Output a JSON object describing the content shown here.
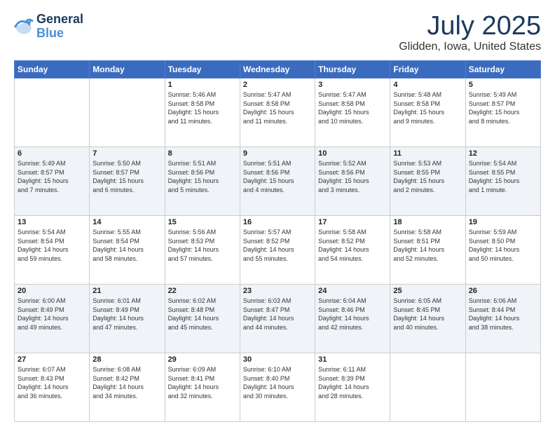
{
  "logo": {
    "line1": "General",
    "line2": "Blue"
  },
  "header": {
    "title": "July 2025",
    "subtitle": "Glidden, Iowa, United States"
  },
  "weekdays": [
    "Sunday",
    "Monday",
    "Tuesday",
    "Wednesday",
    "Thursday",
    "Friday",
    "Saturday"
  ],
  "weeks": [
    [
      {
        "day": "",
        "info": ""
      },
      {
        "day": "",
        "info": ""
      },
      {
        "day": "1",
        "info": "Sunrise: 5:46 AM\nSunset: 8:58 PM\nDaylight: 15 hours\nand 11 minutes."
      },
      {
        "day": "2",
        "info": "Sunrise: 5:47 AM\nSunset: 8:58 PM\nDaylight: 15 hours\nand 11 minutes."
      },
      {
        "day": "3",
        "info": "Sunrise: 5:47 AM\nSunset: 8:58 PM\nDaylight: 15 hours\nand 10 minutes."
      },
      {
        "day": "4",
        "info": "Sunrise: 5:48 AM\nSunset: 8:58 PM\nDaylight: 15 hours\nand 9 minutes."
      },
      {
        "day": "5",
        "info": "Sunrise: 5:49 AM\nSunset: 8:57 PM\nDaylight: 15 hours\nand 8 minutes."
      }
    ],
    [
      {
        "day": "6",
        "info": "Sunrise: 5:49 AM\nSunset: 8:57 PM\nDaylight: 15 hours\nand 7 minutes."
      },
      {
        "day": "7",
        "info": "Sunrise: 5:50 AM\nSunset: 8:57 PM\nDaylight: 15 hours\nand 6 minutes."
      },
      {
        "day": "8",
        "info": "Sunrise: 5:51 AM\nSunset: 8:56 PM\nDaylight: 15 hours\nand 5 minutes."
      },
      {
        "day": "9",
        "info": "Sunrise: 5:51 AM\nSunset: 8:56 PM\nDaylight: 15 hours\nand 4 minutes."
      },
      {
        "day": "10",
        "info": "Sunrise: 5:52 AM\nSunset: 8:56 PM\nDaylight: 15 hours\nand 3 minutes."
      },
      {
        "day": "11",
        "info": "Sunrise: 5:53 AM\nSunset: 8:55 PM\nDaylight: 15 hours\nand 2 minutes."
      },
      {
        "day": "12",
        "info": "Sunrise: 5:54 AM\nSunset: 8:55 PM\nDaylight: 15 hours\nand 1 minute."
      }
    ],
    [
      {
        "day": "13",
        "info": "Sunrise: 5:54 AM\nSunset: 8:54 PM\nDaylight: 14 hours\nand 59 minutes."
      },
      {
        "day": "14",
        "info": "Sunrise: 5:55 AM\nSunset: 8:54 PM\nDaylight: 14 hours\nand 58 minutes."
      },
      {
        "day": "15",
        "info": "Sunrise: 5:56 AM\nSunset: 8:53 PM\nDaylight: 14 hours\nand 57 minutes."
      },
      {
        "day": "16",
        "info": "Sunrise: 5:57 AM\nSunset: 8:52 PM\nDaylight: 14 hours\nand 55 minutes."
      },
      {
        "day": "17",
        "info": "Sunrise: 5:58 AM\nSunset: 8:52 PM\nDaylight: 14 hours\nand 54 minutes."
      },
      {
        "day": "18",
        "info": "Sunrise: 5:58 AM\nSunset: 8:51 PM\nDaylight: 14 hours\nand 52 minutes."
      },
      {
        "day": "19",
        "info": "Sunrise: 5:59 AM\nSunset: 8:50 PM\nDaylight: 14 hours\nand 50 minutes."
      }
    ],
    [
      {
        "day": "20",
        "info": "Sunrise: 6:00 AM\nSunset: 8:49 PM\nDaylight: 14 hours\nand 49 minutes."
      },
      {
        "day": "21",
        "info": "Sunrise: 6:01 AM\nSunset: 8:49 PM\nDaylight: 14 hours\nand 47 minutes."
      },
      {
        "day": "22",
        "info": "Sunrise: 6:02 AM\nSunset: 8:48 PM\nDaylight: 14 hours\nand 45 minutes."
      },
      {
        "day": "23",
        "info": "Sunrise: 6:03 AM\nSunset: 8:47 PM\nDaylight: 14 hours\nand 44 minutes."
      },
      {
        "day": "24",
        "info": "Sunrise: 6:04 AM\nSunset: 8:46 PM\nDaylight: 14 hours\nand 42 minutes."
      },
      {
        "day": "25",
        "info": "Sunrise: 6:05 AM\nSunset: 8:45 PM\nDaylight: 14 hours\nand 40 minutes."
      },
      {
        "day": "26",
        "info": "Sunrise: 6:06 AM\nSunset: 8:44 PM\nDaylight: 14 hours\nand 38 minutes."
      }
    ],
    [
      {
        "day": "27",
        "info": "Sunrise: 6:07 AM\nSunset: 8:43 PM\nDaylight: 14 hours\nand 36 minutes."
      },
      {
        "day": "28",
        "info": "Sunrise: 6:08 AM\nSunset: 8:42 PM\nDaylight: 14 hours\nand 34 minutes."
      },
      {
        "day": "29",
        "info": "Sunrise: 6:09 AM\nSunset: 8:41 PM\nDaylight: 14 hours\nand 32 minutes."
      },
      {
        "day": "30",
        "info": "Sunrise: 6:10 AM\nSunset: 8:40 PM\nDaylight: 14 hours\nand 30 minutes."
      },
      {
        "day": "31",
        "info": "Sunrise: 6:11 AM\nSunset: 8:39 PM\nDaylight: 14 hours\nand 28 minutes."
      },
      {
        "day": "",
        "info": ""
      },
      {
        "day": "",
        "info": ""
      }
    ]
  ]
}
